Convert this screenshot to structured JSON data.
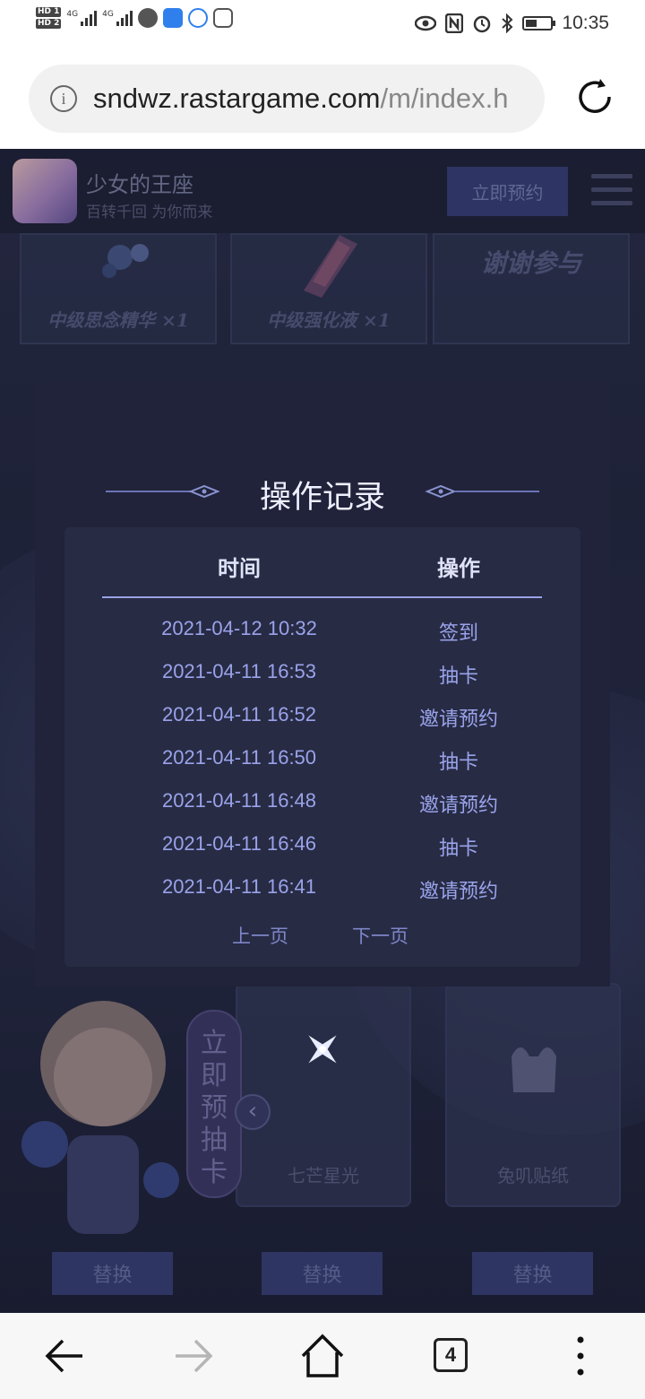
{
  "status_bar": {
    "hd_badges": [
      "HD 1",
      "HD 2"
    ],
    "signal_labels": [
      "4G",
      "4G"
    ],
    "time": "10:35",
    "battery_level": 0.45,
    "icons": [
      "eye-icon",
      "nfc-icon",
      "alarm-icon",
      "bluetooth-icon",
      "battery-icon"
    ]
  },
  "browser": {
    "url_main": "sndwz.rastargame.com",
    "url_path": "/m/index.h",
    "tab_count": "4"
  },
  "site": {
    "app_name": "少女的王座",
    "app_slogan": "百转千回 为你而来",
    "reserve_button": "立即预约",
    "prizes": [
      {
        "label": "中级思念精华 ×1"
      },
      {
        "label": "中级强化液 ×1"
      },
      {
        "label": "谢谢参与"
      }
    ],
    "side_banner_chars": [
      "立",
      "即",
      "预",
      "抽",
      "卡"
    ],
    "cards": [
      {
        "label": "七芒星光"
      },
      {
        "label": "兔叽贴纸"
      }
    ],
    "swap_buttons": [
      "替换",
      "替换",
      "替换"
    ]
  },
  "modal": {
    "title": "操作记录",
    "columns": [
      "时间",
      "操作"
    ],
    "rows": [
      {
        "time": "2021-04-12 10:32",
        "action": "签到"
      },
      {
        "time": "2021-04-11 16:53",
        "action": "抽卡"
      },
      {
        "time": "2021-04-11 16:52",
        "action": "邀请预约"
      },
      {
        "time": "2021-04-11 16:50",
        "action": "抽卡"
      },
      {
        "time": "2021-04-11 16:48",
        "action": "邀请预约"
      },
      {
        "time": "2021-04-11 16:46",
        "action": "抽卡"
      },
      {
        "time": "2021-04-11 16:41",
        "action": "邀请预约"
      }
    ],
    "prev_page": "上一页",
    "next_page": "下一页"
  },
  "colors": {
    "modal_bg": "#202339",
    "panel_bg": "#272b44",
    "row_text": "#9aa3ea",
    "header_line": "#9aa3e6"
  }
}
